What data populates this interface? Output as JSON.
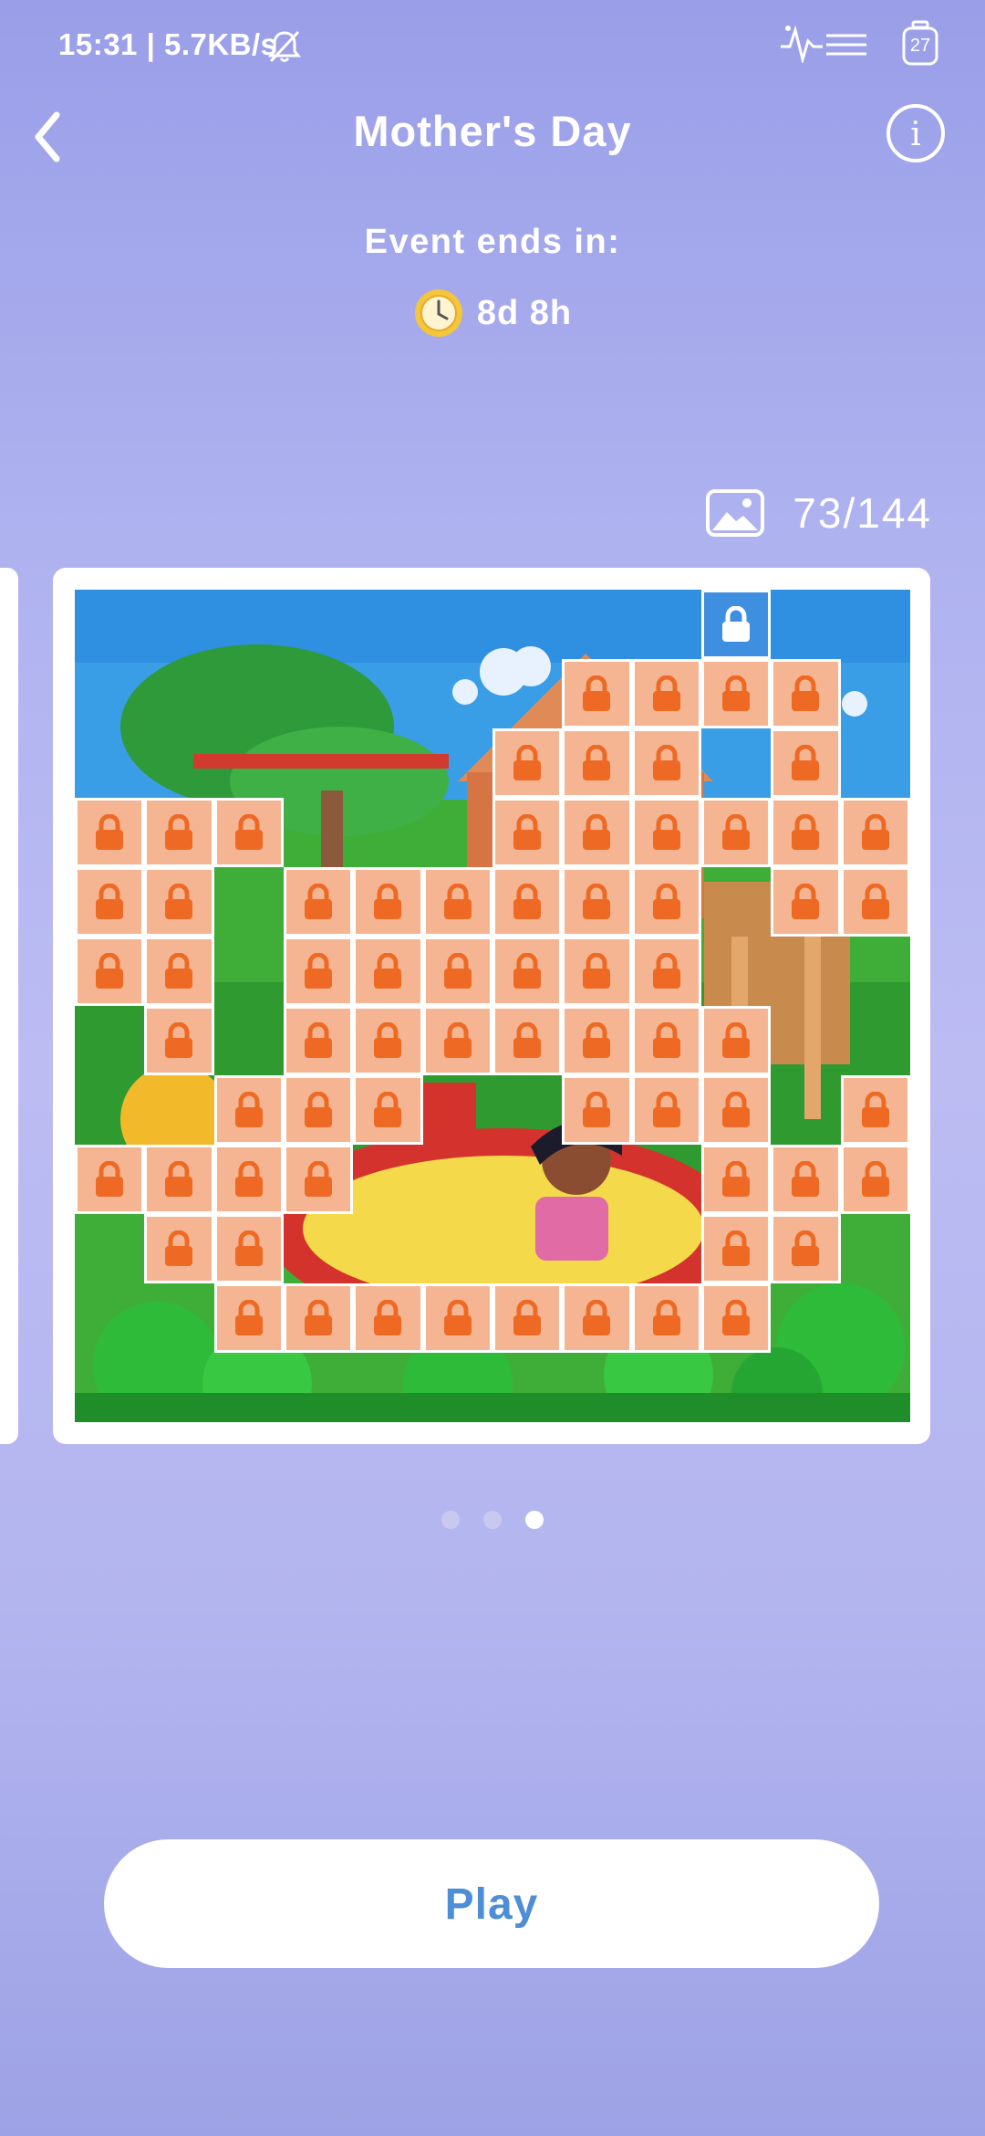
{
  "status_bar": {
    "time": "15:31 | 5.7KB/s",
    "battery": "27",
    "icons": [
      "bell-muted-icon",
      "network-speed-icon",
      "battery-icon"
    ]
  },
  "header": {
    "title": "Mother's Day",
    "back_icon": "chevron-left-icon",
    "info_icon": "info-icon",
    "info_glyph": "i"
  },
  "event": {
    "label": "Event ends in:",
    "countdown": "8d 8h",
    "clock_icon": "clock-icon"
  },
  "progress": {
    "icon": "image-icon",
    "count": "73/144"
  },
  "puzzle": {
    "grid_size": 12,
    "lock_icon": "lock-icon",
    "accent_locked": "#f5b593",
    "lock_color": "#ee6a24",
    "highlight": "#3f8fe0",
    "rows": [
      "000000000B00",
      "0000000LLLL0",
      "000000LLL0L0",
      "LLL000LLLLLL",
      "LL0LLLLLL0LL",
      "LL0LLLLLL000",
      "0L0LLLLLLL00",
      "00LLL00LLL0L",
      "LLLL00000LLLL",
      "0LL000000LL0",
      "00LLLLLLLL00",
      "000000000000"
    ]
  },
  "pager": {
    "pages": 3,
    "active": 2
  },
  "play_button": {
    "label": "Play"
  }
}
